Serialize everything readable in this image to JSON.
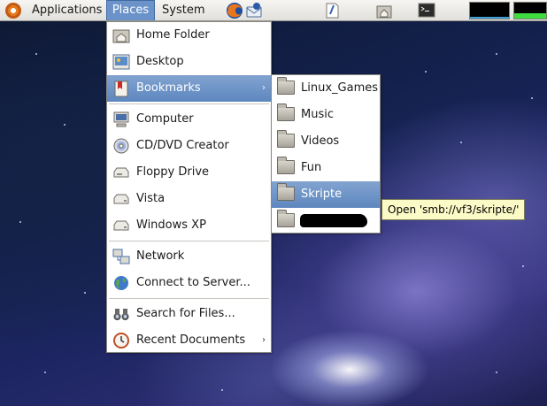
{
  "panel": {
    "applications_label": "Applications",
    "places_label": "Places",
    "system_label": "System",
    "launchers": [
      "firefox-icon",
      "thunderbird-icon",
      "text-editor-icon",
      "home-folder-icon",
      "terminal-icon"
    ],
    "monitors": [
      {
        "name": "system-monitor",
        "color": "#3fa0d8",
        "level": 0.1
      },
      {
        "name": "network-monitor",
        "color": "#3fdc3f",
        "level": 0.35
      }
    ]
  },
  "places_menu": {
    "items": [
      {
        "label": "Home Folder",
        "icon": "home-folder-icon"
      },
      {
        "label": "Desktop",
        "icon": "desktop-icon"
      },
      {
        "label": "Bookmarks",
        "icon": "bookmarks-icon",
        "submenu": true,
        "highlighted": true
      },
      {
        "label": "Computer",
        "icon": "computer-icon"
      },
      {
        "label": "CD/DVD Creator",
        "icon": "cd-dvd-icon"
      },
      {
        "label": "Floppy Drive",
        "icon": "floppy-drive-icon"
      },
      {
        "label": "Vista",
        "icon": "drive-icon"
      },
      {
        "label": "Windows XP",
        "icon": "drive-icon"
      },
      {
        "label": "Network",
        "icon": "network-icon"
      },
      {
        "label": "Connect to Server...",
        "icon": "globe-icon"
      },
      {
        "label": "Search for Files...",
        "icon": "binoculars-icon"
      },
      {
        "label": "Recent Documents",
        "icon": "recent-documents-icon",
        "submenu": true
      }
    ],
    "submenu_arrow": "›"
  },
  "bookmarks_menu": {
    "items": [
      {
        "label": "Linux_Games",
        "icon": "folder-icon"
      },
      {
        "label": "Music",
        "icon": "folder-icon"
      },
      {
        "label": "Videos",
        "icon": "folder-icon"
      },
      {
        "label": "Fun",
        "icon": "folder-icon"
      },
      {
        "label": "Skripte",
        "icon": "folder-icon",
        "highlighted": true
      },
      {
        "label": "",
        "icon": "folder-icon",
        "redacted": true
      }
    ]
  },
  "tooltip": {
    "text": "Open 'smb://vf3/skripte/'"
  },
  "colors": {
    "highlight": "#6b93c9",
    "tooltip_bg": "#fbfbc7"
  }
}
